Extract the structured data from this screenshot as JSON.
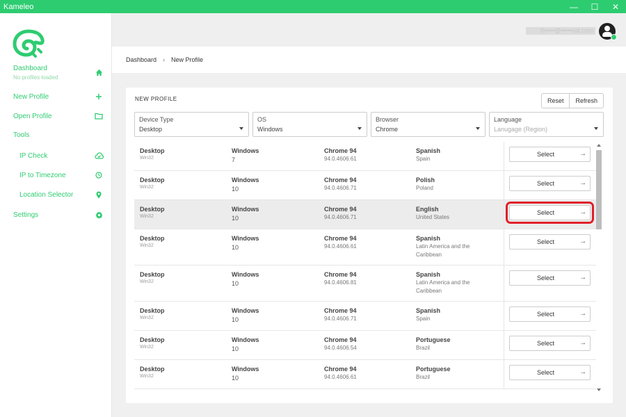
{
  "window": {
    "title": "Kameleo"
  },
  "sidebar": {
    "items": [
      {
        "label": "Dashboard",
        "sub": "No profiles loaded",
        "icon": "home-icon"
      },
      {
        "label": "New Profile",
        "icon": "plus-icon"
      },
      {
        "label": "Open Profile",
        "icon": "folder-icon"
      },
      {
        "label": "Tools"
      },
      {
        "label": "IP Check",
        "icon": "cloud-check-icon"
      },
      {
        "label": "IP to Timezone",
        "icon": "clock-icon"
      },
      {
        "label": "Location Selector",
        "icon": "location-pin-icon"
      },
      {
        "label": "Settings",
        "icon": "gear-icon"
      }
    ]
  },
  "header": {
    "email": "th••••@•••••val.com"
  },
  "breadcrumb": {
    "root": "Dashboard",
    "sep": "›",
    "current": "New Profile"
  },
  "card": {
    "title": "NEW PROFILE",
    "reset_label": "Reset",
    "refresh_label": "Refresh"
  },
  "filters": [
    {
      "label": "Device Type",
      "value": "Desktop",
      "placeholder": false
    },
    {
      "label": "OS",
      "value": "Windows",
      "placeholder": false
    },
    {
      "label": "Browser",
      "value": "Chrome",
      "placeholder": false
    },
    {
      "label": "Language",
      "value": "Lanugage (Region)",
      "placeholder": true
    }
  ],
  "profiles": [
    {
      "device": "Desktop",
      "platform": "Win32",
      "os": "Windows",
      "os_version": "7",
      "browser": "Chrome 94",
      "browser_version": "94.0.4606.61",
      "language": "Spanish",
      "region": "Spain",
      "button": "Select"
    },
    {
      "device": "Desktop",
      "platform": "Win32",
      "os": "Windows",
      "os_version": "10",
      "browser": "Chrome 94",
      "browser_version": "94.0.4606.71",
      "language": "Polish",
      "region": "Poland",
      "button": "Select"
    },
    {
      "device": "Desktop",
      "platform": "Win32",
      "os": "Windows",
      "os_version": "10",
      "browser": "Chrome 94",
      "browser_version": "94.0.4606.71",
      "language": "English",
      "region": "United States",
      "button": "Select",
      "highlighted": true
    },
    {
      "device": "Desktop",
      "platform": "Win32",
      "os": "Windows",
      "os_version": "10",
      "browser": "Chrome 94",
      "browser_version": "94.0.4606.61",
      "language": "Spanish",
      "region": "Latin America and the Caribbean",
      "button": "Select"
    },
    {
      "device": "Desktop",
      "platform": "Win32",
      "os": "Windows",
      "os_version": "10",
      "browser": "Chrome 94",
      "browser_version": "94.0.4606.81",
      "language": "Spanish",
      "region": "Latin America and the Caribbean",
      "button": "Select"
    },
    {
      "device": "Desktop",
      "platform": "Win32",
      "os": "Windows",
      "os_version": "10",
      "browser": "Chrome 94",
      "browser_version": "94.0.4606.71",
      "language": "Spanish",
      "region": "Spain",
      "button": "Select"
    },
    {
      "device": "Desktop",
      "platform": "Win32",
      "os": "Windows",
      "os_version": "10",
      "browser": "Chrome 94",
      "browser_version": "94.0.4606.54",
      "language": "Portuguese",
      "region": "Brazil",
      "button": "Select"
    },
    {
      "device": "Desktop",
      "platform": "Win32",
      "os": "Windows",
      "os_version": "10",
      "browser": "Chrome 94",
      "browser_version": "94.0.4606.61",
      "language": "Portuguese",
      "region": "Brazil",
      "button": "Select"
    }
  ],
  "colors": {
    "accent": "#2ecc71",
    "highlight_outline": "#e0202a"
  }
}
